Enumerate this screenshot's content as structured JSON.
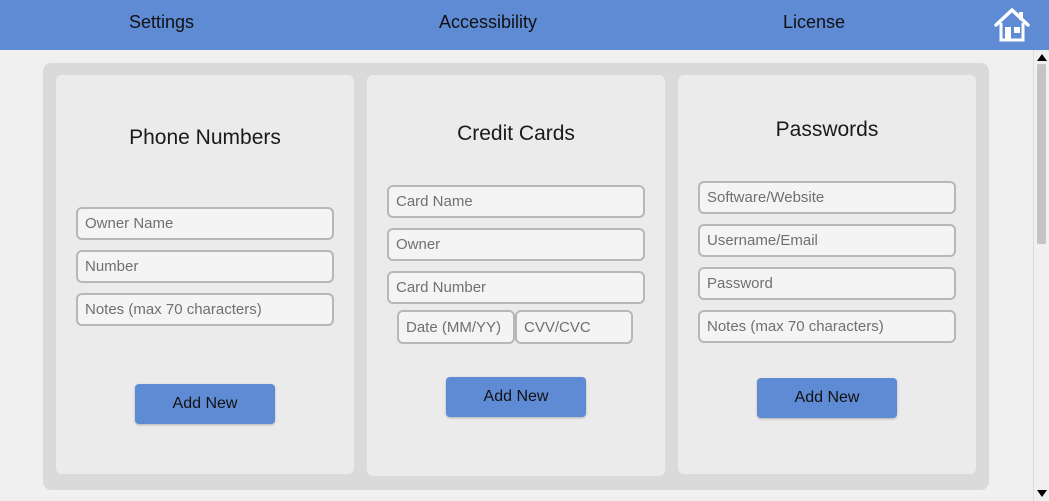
{
  "nav": {
    "settings": "Settings",
    "accessibility": "Accessibility",
    "license": "License",
    "home_icon": "home-icon"
  },
  "phone_numbers": {
    "title": "Phone Numbers",
    "owner_name_placeholder": "Owner Name",
    "number_placeholder": "Number",
    "notes_placeholder": "Notes (max 70 characters)",
    "add_label": "Add New"
  },
  "credit_cards": {
    "title": "Credit Cards",
    "card_name_placeholder": "Card Name",
    "owner_placeholder": "Owner",
    "card_number_placeholder": "Card Number",
    "date_placeholder": "Date (MM/YY)",
    "cvv_placeholder": "CVV/CVC",
    "add_label": "Add New"
  },
  "passwords": {
    "title": "Passwords",
    "site_placeholder": "Software/Website",
    "username_placeholder": "Username/Email",
    "password_placeholder": "Password",
    "notes_placeholder": "Notes (max 70 characters)",
    "add_label": "Add New"
  },
  "colors": {
    "accent": "#5f8bd5",
    "panel": "#dadada",
    "card": "#ebebeb",
    "background": "#f0f0f0"
  }
}
